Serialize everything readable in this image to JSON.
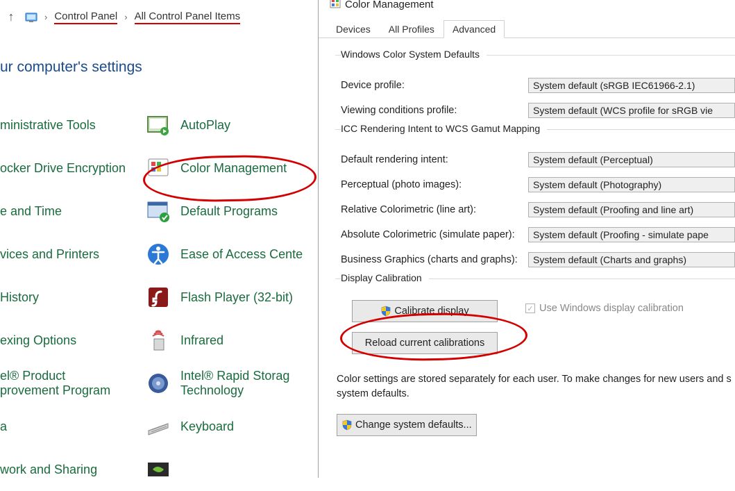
{
  "breadcrumb": {
    "item1": "Control Panel",
    "item2": "All Control Panel Items"
  },
  "page_title": "ur computer's settings",
  "cp_items": {
    "col1": [
      "ministrative Tools",
      "ocker Drive Encryption",
      "e and Time",
      "vices and Printers",
      " History",
      "exing Options",
      "el® Product\nprovement Program",
      "a",
      "work and Sharing"
    ],
    "col2": [
      "AutoPlay",
      "Color Management",
      "Default Programs",
      "Ease of Access Cente",
      "Flash Player (32-bit)",
      "Infrared",
      "Intel® Rapid Storag\nTechnology",
      "Keyboard",
      ""
    ]
  },
  "dialog": {
    "title": "Color Management",
    "tabs": {
      "devices": "Devices",
      "all_profiles": "All Profiles",
      "advanced": "Advanced"
    },
    "group1": {
      "title": "Windows Color System Defaults",
      "device_profile_label": "Device profile:",
      "device_profile_value": "System default (sRGB IEC61966-2.1)",
      "viewing_label": "Viewing conditions profile:",
      "viewing_value": "System default (WCS profile for sRGB vie"
    },
    "group2": {
      "title": "ICC Rendering Intent to WCS Gamut Mapping",
      "default_intent_label": "Default rendering intent:",
      "default_intent_value": "System default (Perceptual)",
      "perceptual_label": "Perceptual (photo images):",
      "perceptual_value": "System default (Photography)",
      "relcol_label": "Relative Colorimetric (line art):",
      "relcol_value": "System default (Proofing and line art)",
      "abscol_label": "Absolute Colorimetric (simulate paper):",
      "abscol_value": "System default (Proofing - simulate pape",
      "business_label": "Business Graphics (charts and graphs):",
      "business_value": "System default (Charts and graphs)"
    },
    "group3": {
      "title": "Display Calibration",
      "calibrate_btn": "Calibrate display",
      "reload_btn": "Reload current calibrations",
      "use_win_calib": "Use Windows display calibration"
    },
    "info_text": "Color settings are stored separately for each user. To make changes for new users and s\nsystem defaults.",
    "change_defaults_btn": "Change system defaults..."
  }
}
